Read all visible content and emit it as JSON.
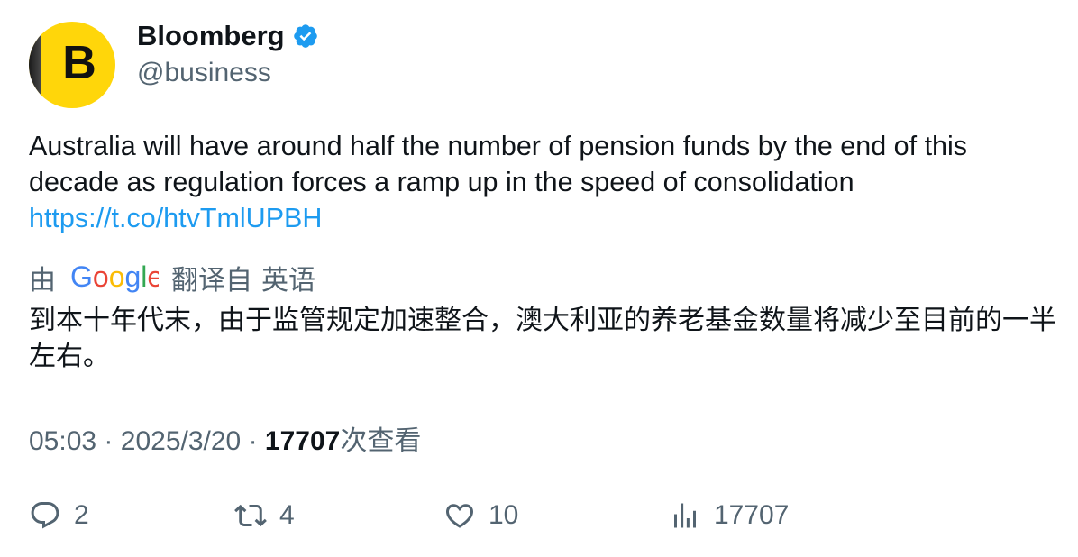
{
  "author": {
    "avatar_letter": "B",
    "name": "Bloomberg",
    "handle": "@business",
    "verified": true
  },
  "tweet": {
    "text": "Australia will have around half the number of pension funds by the end of this decade as regulation forces a ramp up in the speed of consolidation",
    "link": "https://t.co/htvTmlUPBH"
  },
  "translation": {
    "by_label": "由",
    "provider": "Google",
    "translated_from": "翻译自",
    "language": "英语",
    "text": "到本十年代末，由于监管规定加速整合，澳大利亚的养老基金数量将减少至目前的一半左右。"
  },
  "meta": {
    "time": "05:03",
    "separator": "·",
    "date": "2025/3/20",
    "views_count": "17707",
    "views_label": "次查看"
  },
  "actions": {
    "replies": "2",
    "retweets": "4",
    "likes": "10",
    "views": "17707"
  },
  "colors": {
    "verified_badge": "#1d9bf0",
    "link": "#1d9bf0",
    "avatar_bg": "#ffd60a",
    "secondary_text": "#536471"
  },
  "icons": [
    "verified-badge-icon",
    "google-logo",
    "reply-icon",
    "retweet-icon",
    "like-icon",
    "views-icon"
  ]
}
